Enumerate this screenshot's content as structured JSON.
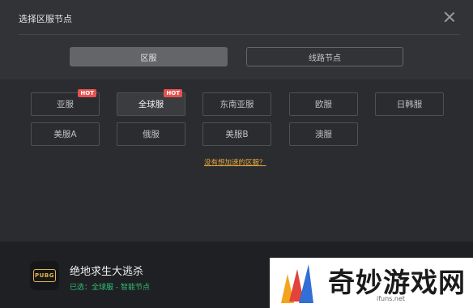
{
  "header": {
    "title": "选择区服节点",
    "close_icon": "close-icon"
  },
  "tabs": [
    {
      "label": "区服",
      "active": true
    },
    {
      "label": "线路节点",
      "active": false
    }
  ],
  "regions": [
    {
      "label": "亚服",
      "hot": "HOT"
    },
    {
      "label": "全球服",
      "hot": "HOT",
      "selected": true
    },
    {
      "label": "东南亚服"
    },
    {
      "label": "欧服"
    },
    {
      "label": "日韩服"
    },
    {
      "label": "美服A"
    },
    {
      "label": "俄服"
    },
    {
      "label": "美服B"
    },
    {
      "label": "澳服"
    }
  ],
  "help_link": "没有想加速的区服？",
  "footer": {
    "game_icon_text": "PUBG",
    "game_name": "绝地求生大逃杀",
    "status": "已选：全球服 - 智能节点"
  },
  "watermark": {
    "text": "奇妙游戏网",
    "url": "ifuns.net"
  },
  "colors": {
    "accent_hot": "#e6524f",
    "status_green": "#2fbf77",
    "link_orange": "#e8a93a"
  }
}
